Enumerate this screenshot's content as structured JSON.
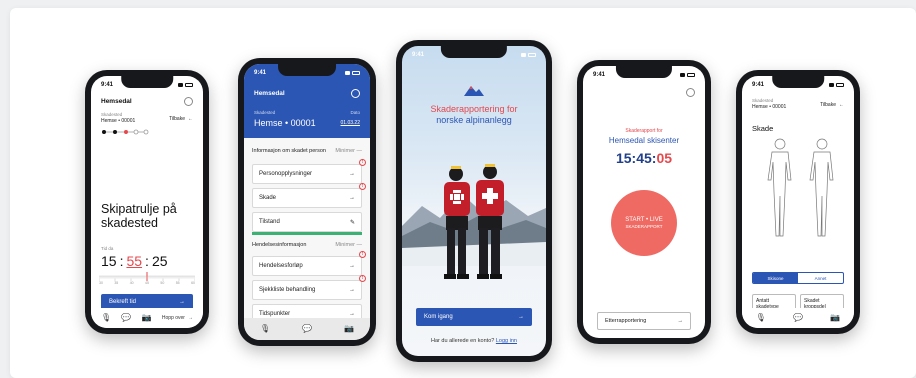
{
  "status_time": "9:41",
  "phone1": {
    "location": "Hemsedal",
    "station_label": "Skadested",
    "station_value": "Hemse • 00001",
    "back_label": "Tilbake",
    "headline": "Skipatrulje på skadested",
    "time_label": "Tid da",
    "time_h": "15",
    "time_m": "55",
    "time_s": "25",
    "ruler_ticks": [
      "30",
      "35",
      "40",
      "45",
      "50",
      "55",
      "60"
    ],
    "button_label": "Bekreft tid",
    "skip_label": "Hopp over"
  },
  "phone2": {
    "location": "Hemsedal",
    "station_label": "Skadested",
    "station_value": "Hemse • 00001",
    "date_label": "Dato",
    "date_value": "01.03.22",
    "section1": "Informasjon om skadet person",
    "section1_action": "Minimer",
    "items1": [
      "Personopplysninger",
      "Skade",
      "Tilstand"
    ],
    "section2": "Hendelsesinformasjon",
    "section2_action": "Minimer",
    "items2": [
      "Hendelsesforløp",
      "Sjekkliste behandling",
      "Tidspunkter"
    ]
  },
  "phone3": {
    "title_line1": "Skaderapportering for",
    "title_line2": "norske alpinanlegg",
    "button_label": "Kom igang",
    "footer_text": "Har du allerede en konto?",
    "footer_link": "Logg inn"
  },
  "phone4": {
    "subtitle": "Skaderapport for",
    "resort": "Hemsedal skisenter",
    "clock_hm": "15:45:",
    "clock_s": "05",
    "start_line1": "START • LIVE",
    "start_line2": "SKADERAPPORT",
    "bottom_button": "Etterrapportering"
  },
  "phone5": {
    "station_label": "Skadested",
    "station_value": "Hemse • 00001",
    "back_label": "Tilbake",
    "title": "Skade",
    "toggle_a": "Skisone",
    "toggle_b": "Annet",
    "card_a": "Antatt skadetype",
    "card_b": "Skadet kroppsdel"
  },
  "colors": {
    "primary_blue": "#2c56b4",
    "accent_red": "#e5484d",
    "start_circle": "#ef6a63",
    "success_green": "#3bb273"
  }
}
